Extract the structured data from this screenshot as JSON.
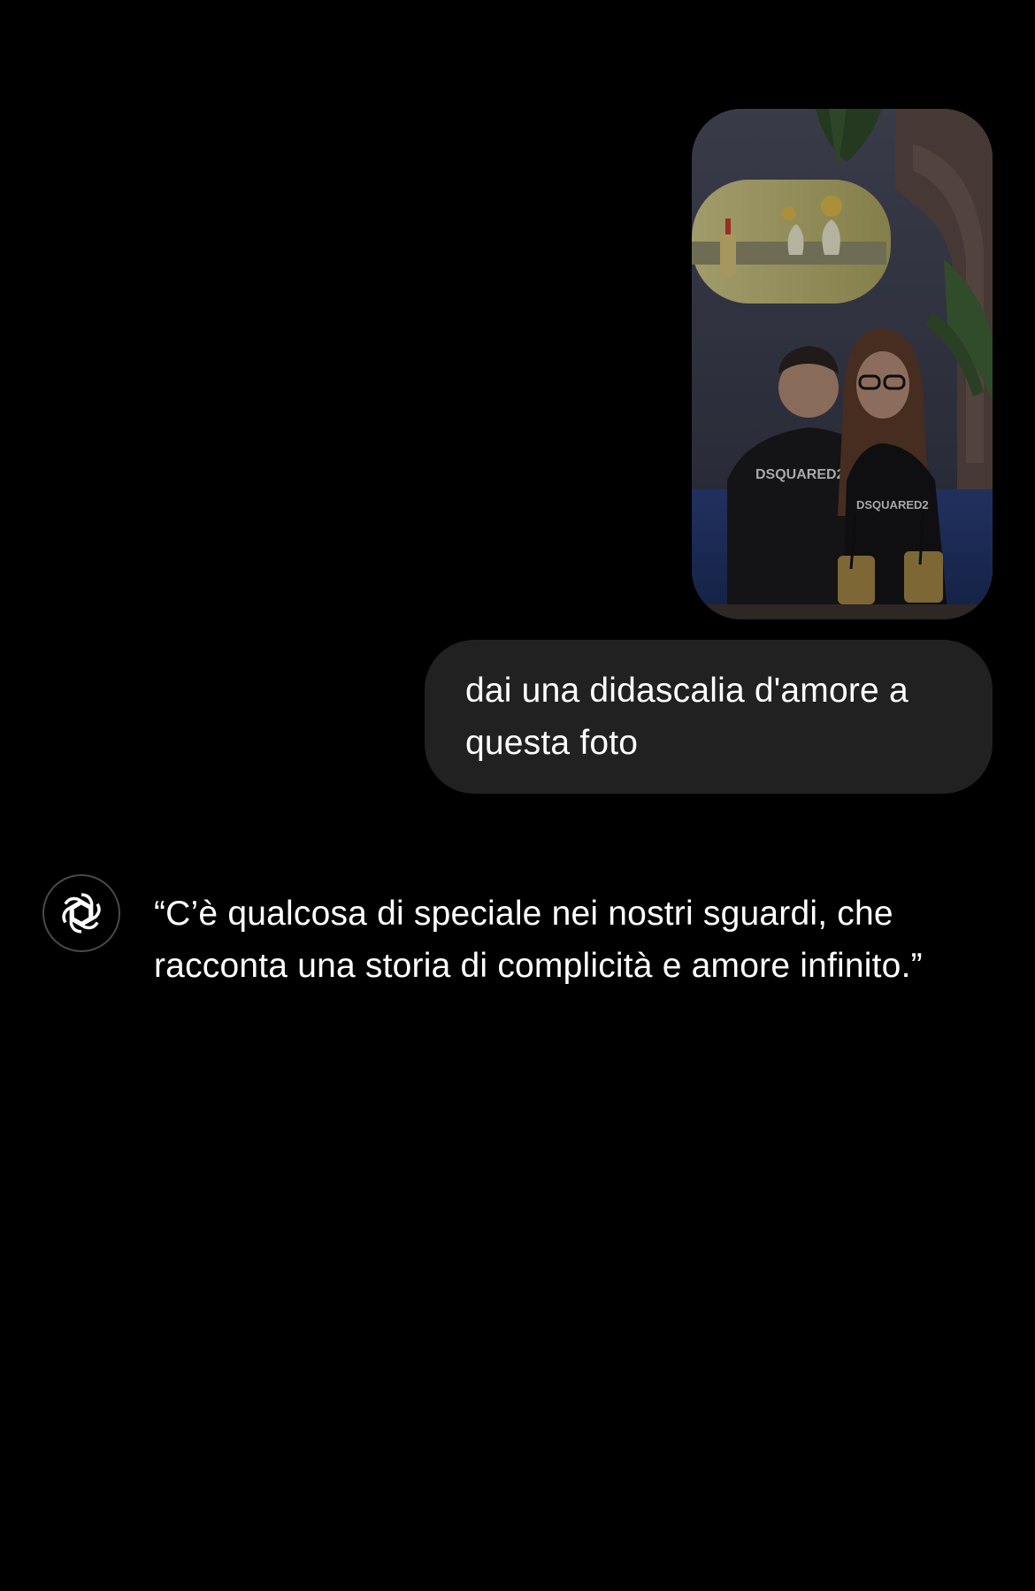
{
  "conversation": {
    "user_attachment": {
      "kind": "photo",
      "shirt_text": "DSQUARED2"
    },
    "user_message": {
      "text": "dai una didascalia d'amore a questa foto"
    },
    "assistant_message": {
      "avatar_icon": "openai-logo-icon",
      "text": "“C’è qualcosa di speciale nei nostri sguardi, che racconta una storia di complicità e amore infinito.”"
    }
  },
  "colors": {
    "background": "#000000",
    "user_bubble": "#212121",
    "text": "#ffffff",
    "avatar_border": "#4a4a4a"
  }
}
